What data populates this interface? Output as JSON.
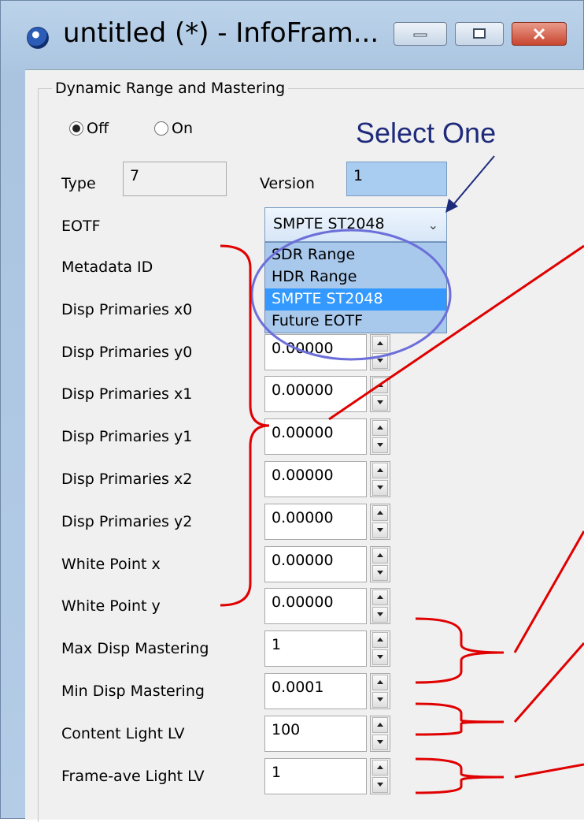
{
  "window": {
    "title": "untitled (*) - InfoFram...",
    "buttons": [
      "minimize",
      "maximize",
      "close"
    ]
  },
  "group": {
    "title": "Dynamic Range and Mastering",
    "radio": {
      "off_label": "Off",
      "on_label": "On",
      "selected": "Off"
    }
  },
  "type_label": "Type",
  "type_value": "7",
  "version_label": "Version",
  "version_value": "1",
  "eotf_label": "EOTF",
  "eotf_selected": "SMPTE ST2048",
  "eotf_options": [
    "SDR Range",
    "HDR Range",
    "SMPTE ST2048",
    "Future EOTF"
  ],
  "fields": [
    {
      "label": "Metadata ID",
      "value": ""
    },
    {
      "label": "Disp Primaries x0",
      "value": ""
    },
    {
      "label": "Disp Primaries y0",
      "value": "0.00000"
    },
    {
      "label": "Disp Primaries x1",
      "value": "0.00000"
    },
    {
      "label": "Disp Primaries y1",
      "value": "0.00000"
    },
    {
      "label": "Disp Primaries x2",
      "value": "0.00000"
    },
    {
      "label": "Disp Primaries y2",
      "value": "0.00000"
    },
    {
      "label": "White Point x",
      "value": "0.00000"
    },
    {
      "label": "White Point y",
      "value": "0.00000"
    },
    {
      "label": "Max Disp Mastering",
      "value": "1"
    },
    {
      "label": "Min Disp Mastering",
      "value": "0.0001"
    },
    {
      "label": "Content Light LV",
      "value": "100"
    },
    {
      "label": "Frame-ave Light LV",
      "value": "1"
    }
  ],
  "annotation": {
    "text": "Select One",
    "color": "#1e2a7a",
    "bracket_color": "#e00000"
  }
}
